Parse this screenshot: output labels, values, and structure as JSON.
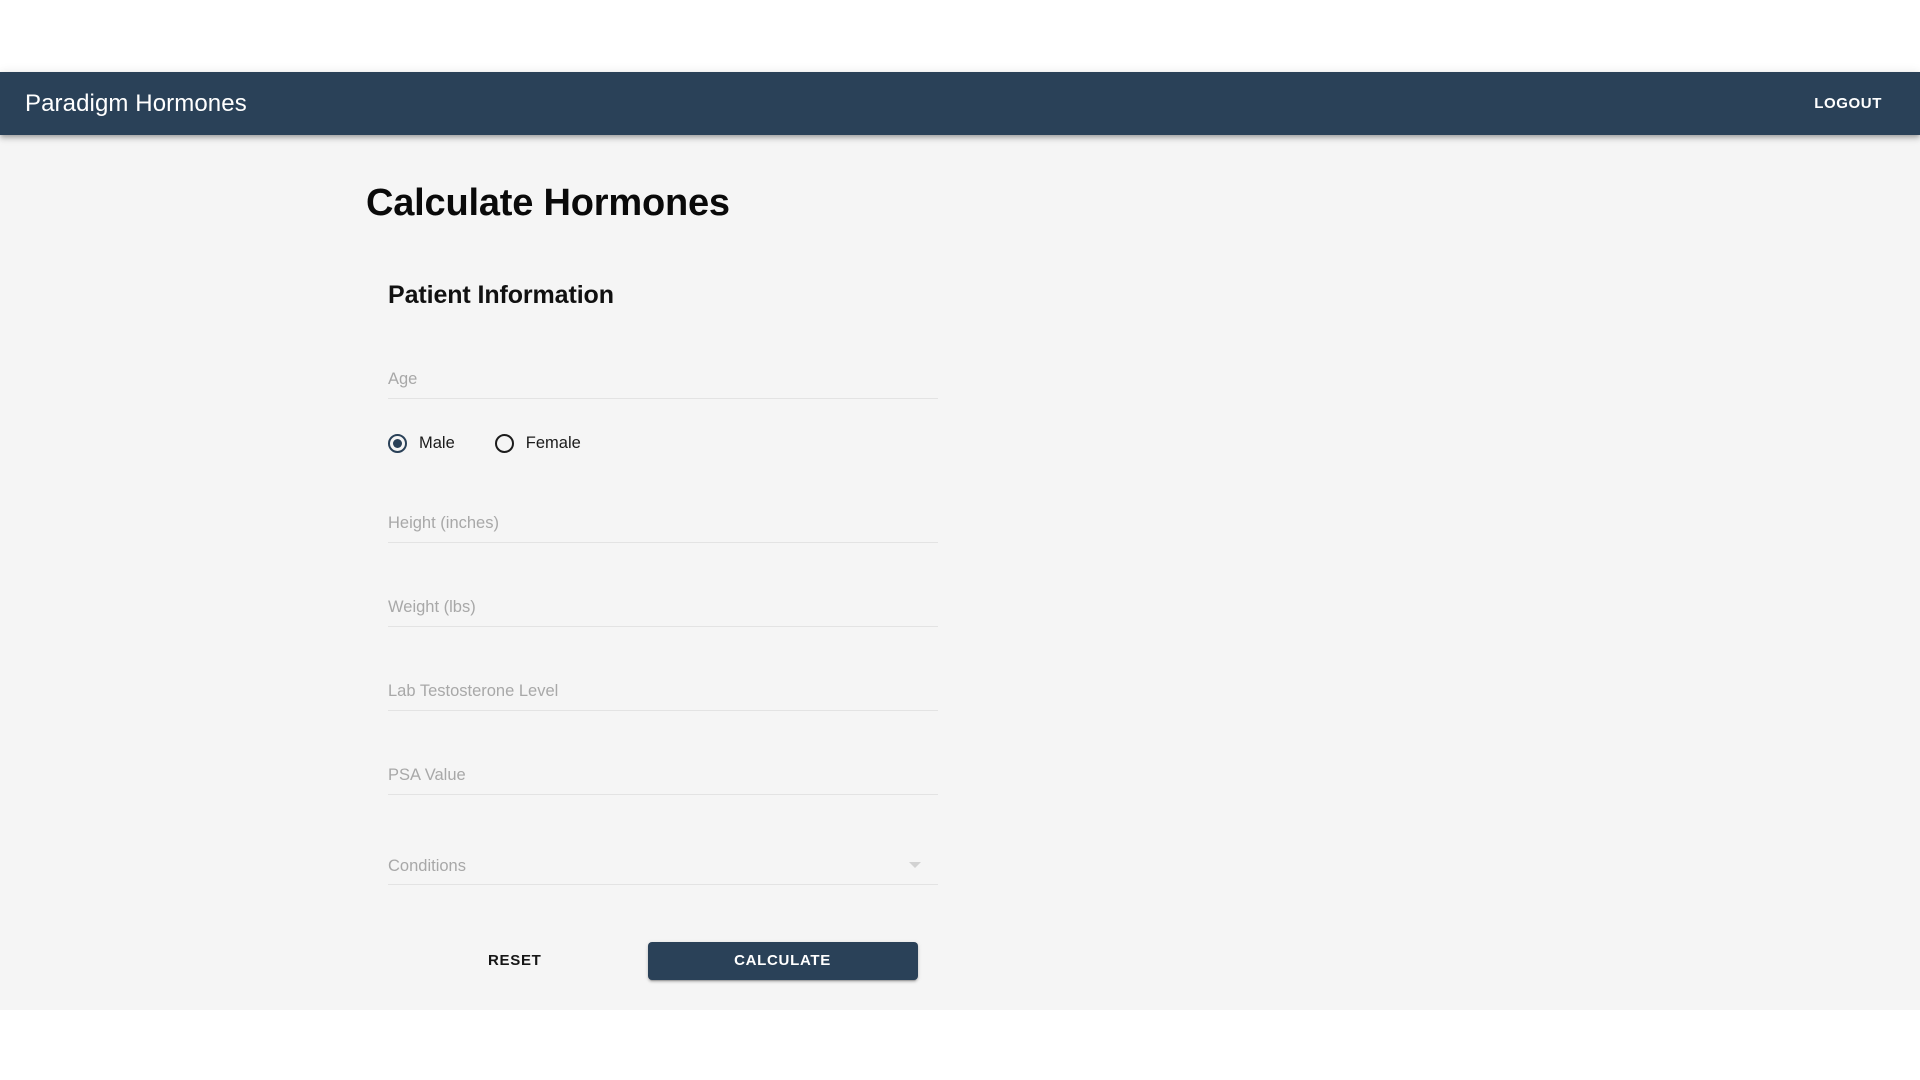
{
  "appbar": {
    "title": "Paradigm Hormones",
    "logout_label": "LOGOUT",
    "background_color": "#2a4158"
  },
  "page": {
    "title": "Calculate Hormones",
    "background_color": "#f5f5f5"
  },
  "form": {
    "section_title": "Patient Information",
    "fields": [
      {
        "name": "age",
        "placeholder": "Age",
        "value": ""
      },
      {
        "name": "height",
        "placeholder": "Height (inches)",
        "value": ""
      },
      {
        "name": "weight",
        "placeholder": "Weight (lbs)",
        "value": ""
      },
      {
        "name": "lab_testosterone",
        "placeholder": "Lab Testosterone Level",
        "value": ""
      },
      {
        "name": "psa",
        "placeholder": "PSA Value",
        "value": ""
      }
    ],
    "gender": {
      "selected": "Male",
      "options": [
        {
          "label": "Male",
          "checked": true
        },
        {
          "label": "Female",
          "checked": false
        }
      ]
    },
    "conditions": {
      "placeholder": "Conditions",
      "value": "",
      "arrow_icon": "chevron-down-icon"
    },
    "buttons": {
      "reset_label": "RESET",
      "calculate_label": "CALCULATE",
      "calculate_color": "#2a4158"
    }
  }
}
